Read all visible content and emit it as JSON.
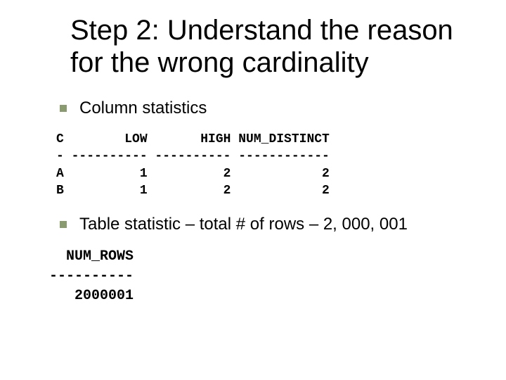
{
  "title": "Step 2: Understand the reason for the wrong cardinality",
  "bullets": {
    "b1": "Column statistics",
    "b2": "Table statistic – total # of rows – 2, 000, 001"
  },
  "code1": "C        LOW       HIGH NUM_DISTINCT\n- ---------- ---------- ------------\nA          1          2            2\nB          1          2            2",
  "code2": "  NUM_ROWS\n----------\n   2000001"
}
